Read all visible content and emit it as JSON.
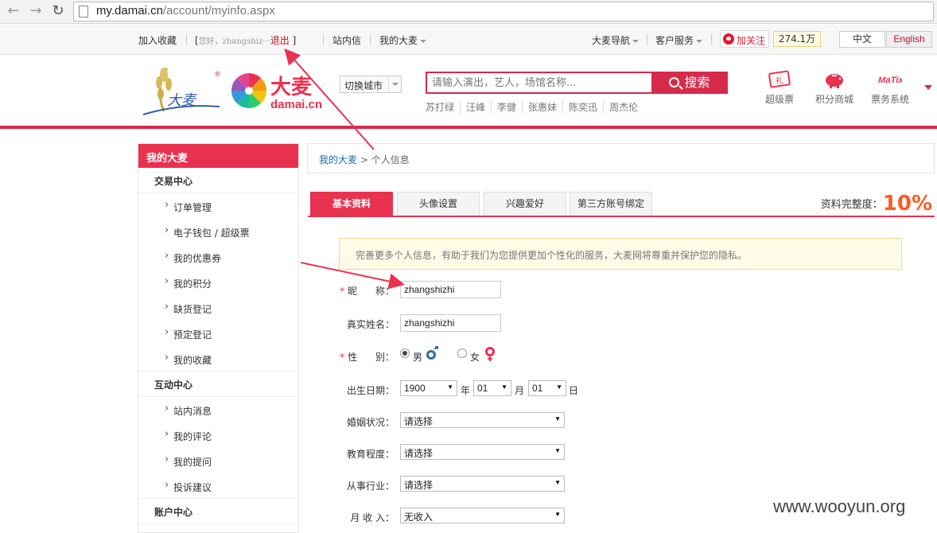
{
  "browser": {
    "url_host": "my.damai.cn",
    "url_path": "/account/myinfo.aspx"
  },
  "topbar": {
    "bookmark": "加入收藏",
    "greeting_open": "[",
    "greeting": "您好，zhangshiz···",
    "logout": "退出",
    "greeting_close": "]",
    "messages": "站内信",
    "my_damai": "我的大麦",
    "site_nav": "大麦导航",
    "customer_service": "客户服务",
    "follow": "加关注",
    "fans": "274.1万",
    "lang_cn": "中文",
    "lang_en": "English"
  },
  "header": {
    "logo_brand_cn": "大麦",
    "logo_brand_en": "damai.cn",
    "city_switch": "切换城市",
    "search_placeholder": "请输入演出，艺人，场馆名称...",
    "search_button": "搜索",
    "hot_words": [
      "苏打绿",
      "汪峰",
      "李健",
      "张惠妹",
      "陈奕迅",
      "周杰伦"
    ],
    "icons": [
      {
        "label": "超级票",
        "icon": "super-ticket-icon"
      },
      {
        "label": "积分商城",
        "icon": "piggy-bank-icon"
      },
      {
        "label": "票务系统",
        "icon": "ticket-system-icon"
      }
    ]
  },
  "sidebar": {
    "title": "我的大麦",
    "groups": [
      {
        "label": "交易中心",
        "items": [
          "订单管理",
          "电子钱包 / 超级票",
          "我的优惠券",
          "我的积分",
          "缺货登记",
          "预定登记",
          "我的收藏"
        ]
      },
      {
        "label": "互动中心",
        "items": [
          "站内消息",
          "我的评论",
          "我的提问",
          "投诉建议"
        ]
      },
      {
        "label": "账户中心",
        "items": []
      }
    ]
  },
  "breadcrumb": {
    "root": "我的大麦",
    "current": "> 个人信息"
  },
  "tabs": [
    "基本资料",
    "头像设置",
    "兴趣爱好",
    "第三方账号绑定"
  ],
  "completeness": {
    "label": "资料完整度：",
    "value": "10%"
  },
  "notice": "完善更多个人信息，有助于我们为您提供更加个性化的服务，大麦网将尊重并保护您的隐私。",
  "form": {
    "nickname": {
      "required": "*",
      "label": "昵      称：",
      "value": "zhangshizhi"
    },
    "realname": {
      "label": "真实姓名：",
      "value": "zhangshizhi"
    },
    "gender": {
      "required": "*",
      "label": "性      别：",
      "male": "男",
      "female": "女",
      "selected": "男"
    },
    "birthday": {
      "label": "出生日期：",
      "year": "1900",
      "year_unit": "年",
      "month": "01",
      "month_unit": "月",
      "day": "01",
      "day_unit": "日"
    },
    "marital": {
      "label": "婚姻状况：",
      "value": "请选择"
    },
    "education": {
      "label": "教育程度：",
      "value": "请选择"
    },
    "industry": {
      "label": "从事行业：",
      "value": "请选择"
    },
    "income": {
      "label": "月 收 入：",
      "value": "无收入"
    }
  },
  "watermark": "www.wooyun.org",
  "colors": {
    "brand_red": "#d62a4a",
    "accent_orange": "#ff5a1f"
  }
}
